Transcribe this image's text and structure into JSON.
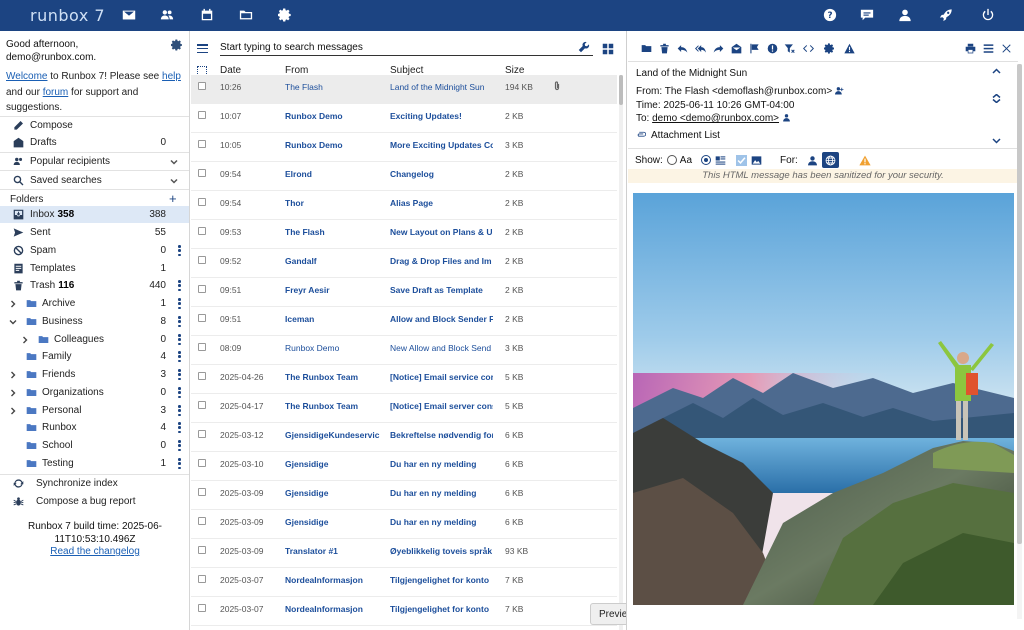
{
  "app": {
    "logo": "runbox 7"
  },
  "colors": {
    "topbar": "#1c4482",
    "link": "#1a5fb4",
    "sender": "#1c4e9b"
  },
  "topnav": [
    "mail-icon",
    "contacts-icon",
    "calendar-icon",
    "files-icon",
    "settings-icon",
    "help-icon",
    "chat-icon",
    "account-icon",
    "rocket-icon",
    "power-icon"
  ],
  "sidebar": {
    "greeting_line1": "Good afternoon,",
    "greeting_line2": "demo@runbox.com.",
    "welcome": {
      "welcome_link": "Welcome",
      "text1": " to Runbox 7! Please see ",
      "help_link": "help",
      "text2": " and our ",
      "forum_link": "forum",
      "text3": " for support and suggestions."
    },
    "compose": "Compose",
    "drafts": {
      "label": "Drafts",
      "count": "0"
    },
    "popular_recipients": "Popular recipients",
    "saved_searches": "Saved searches",
    "folders_header": "Folders",
    "folders": [
      {
        "name": "Inbox",
        "unread": "358",
        "count": "388"
      },
      {
        "name": "Sent",
        "unread": "",
        "count": "55"
      },
      {
        "name": "Spam",
        "unread": "",
        "count": "0"
      },
      {
        "name": "Templates",
        "unread": "",
        "count": "1"
      },
      {
        "name": "Trash",
        "unread": "116",
        "count": "440"
      },
      {
        "name": "Archive",
        "unread": "",
        "count": "1"
      },
      {
        "name": "Business",
        "unread": "",
        "count": "8"
      },
      {
        "name": "Colleagues",
        "unread": "",
        "count": "0"
      },
      {
        "name": "Family",
        "unread": "",
        "count": "4"
      },
      {
        "name": "Friends",
        "unread": "",
        "count": "3"
      },
      {
        "name": "Organizations",
        "unread": "",
        "count": "0"
      },
      {
        "name": "Personal",
        "unread": "",
        "count": "3"
      },
      {
        "name": "Runbox",
        "unread": "",
        "count": "4"
      },
      {
        "name": "School",
        "unread": "",
        "count": "0"
      },
      {
        "name": "Testing",
        "unread": "",
        "count": "1"
      }
    ],
    "sync_index": "Synchronize index",
    "bug_report": "Compose a bug report",
    "build_time": "Runbox 7 build time: 2025-06-11T10:53:10.496Z",
    "changelog": "Read the changelog"
  },
  "messagelist": {
    "search_placeholder": "Start typing to search messages",
    "columns": {
      "date": "Date",
      "from": "From",
      "subject": "Subject",
      "size": "Size"
    },
    "rows": [
      {
        "date": "10:26",
        "from": "The Flash",
        "subject": "Land of the Midnight Sun",
        "size": "194 KB",
        "read": true,
        "attach": true
      },
      {
        "date": "10:07",
        "from": "Runbox Demo",
        "subject": "Exciting Updates!",
        "size": "2 KB",
        "read": false,
        "attach": false
      },
      {
        "date": "10:05",
        "from": "Runbox Demo",
        "subject": "More Exciting Updates Co",
        "size": "3 KB",
        "read": false,
        "attach": false
      },
      {
        "date": "09:54",
        "from": "Elrond",
        "subject": "Changelog",
        "size": "2 KB",
        "read": false,
        "attach": false
      },
      {
        "date": "09:54",
        "from": "Thor",
        "subject": "Alias Page",
        "size": "2 KB",
        "read": false,
        "attach": false
      },
      {
        "date": "09:53",
        "from": "The Flash",
        "subject": "New Layout on Plans & Up",
        "size": "2 KB",
        "read": false,
        "attach": false
      },
      {
        "date": "09:52",
        "from": "Gandalf",
        "subject": "Drag & Drop Files and Im",
        "size": "2 KB",
        "read": false,
        "attach": false
      },
      {
        "date": "09:51",
        "from": "Freyr Aesir",
        "subject": "Save Draft as Template",
        "size": "2 KB",
        "read": false,
        "attach": false
      },
      {
        "date": "09:51",
        "from": "Iceman",
        "subject": "Allow and Block Sender F",
        "size": "2 KB",
        "read": false,
        "attach": false
      },
      {
        "date": "08:09",
        "from": "Runbox Demo",
        "subject": "New Allow and Block Send",
        "size": "3 KB",
        "read": true,
        "attach": false
      },
      {
        "date": "2025-04-26",
        "from": "The Runbox Team",
        "subject": "[Notice] Email service cor",
        "size": "5 KB",
        "read": false,
        "attach": false
      },
      {
        "date": "2025-04-17",
        "from": "The Runbox Team",
        "subject": "[Notice] Email server cons",
        "size": "5 KB",
        "read": false,
        "attach": false
      },
      {
        "date": "2025-03-12",
        "from": "GjensidigeKundeservic",
        "subject": "Bekreftelse nødvendig for",
        "size": "6 KB",
        "read": false,
        "attach": false
      },
      {
        "date": "2025-03-10",
        "from": "Gjensidige",
        "subject": "Du har en ny melding",
        "size": "6 KB",
        "read": false,
        "attach": false
      },
      {
        "date": "2025-03-09",
        "from": "Gjensidige",
        "subject": "Du har en ny melding",
        "size": "6 KB",
        "read": false,
        "attach": false
      },
      {
        "date": "2025-03-09",
        "from": "Gjensidige",
        "subject": "Du har en ny melding",
        "size": "6 KB",
        "read": false,
        "attach": false
      },
      {
        "date": "2025-03-09",
        "from": "Translator #1",
        "subject": "Øyeblikkelig toveis språk",
        "size": "93 KB",
        "read": false,
        "attach": false
      },
      {
        "date": "2025-03-07",
        "from": "NordeaInformasjon",
        "subject": "Tilgjengelighet for konto",
        "size": "7 KB",
        "read": false,
        "attach": false
      },
      {
        "date": "2025-03-07",
        "from": "NordeaInformasjon",
        "subject": "Tilgjengelighet for konto",
        "size": "7 KB",
        "read": false,
        "attach": false
      }
    ],
    "preview_button": "Previe"
  },
  "reading": {
    "subject": "Land of the Midnight Sun",
    "from": "From: The Flash <demoflash@runbox.com>",
    "time": "Time: 2025-06-11 10:26 GMT-04:00",
    "to_label": "To: ",
    "to_value": "demo <demo@runbox.com>",
    "attachment_list": "Attachment List",
    "show_label": "Show:",
    "show_text_option": "Aa",
    "for_label": "For:",
    "sanitized_notice": "This HTML message has been sanitized for your security."
  }
}
